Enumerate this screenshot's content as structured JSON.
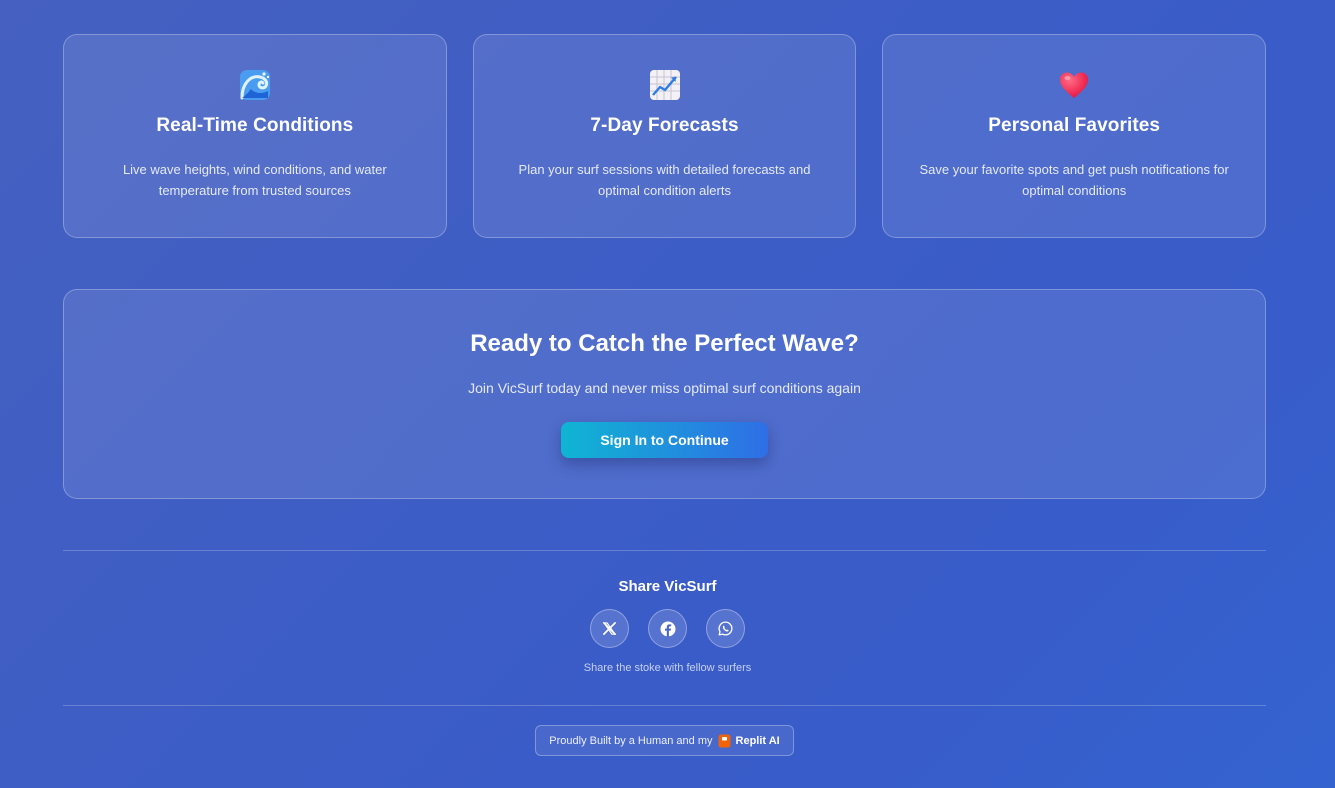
{
  "features": [
    {
      "icon": "wave-icon",
      "title": "Real-Time Conditions",
      "description": "Live wave heights, wind conditions, and water temperature from trusted sources"
    },
    {
      "icon": "chart-increasing-icon",
      "title": "7-Day Forecasts",
      "description": "Plan your surf sessions with detailed forecasts and optimal condition alerts"
    },
    {
      "icon": "heart-icon",
      "title": "Personal Favorites",
      "description": "Save your favorite spots and get push notifications for optimal conditions"
    }
  ],
  "cta": {
    "title": "Ready to Catch the Perfect Wave?",
    "subtitle": "Join VicSurf today and never miss optimal surf conditions again",
    "button_label": "Sign In to Continue"
  },
  "share": {
    "title": "Share VicSurf",
    "buttons": [
      "x-icon",
      "facebook-icon",
      "whatsapp-icon"
    ],
    "caption": "Share the stoke with fellow surfers"
  },
  "footer": {
    "built_prefix": "Proudly Built by a Human and my",
    "built_brand": "Replit AI"
  },
  "colors": {
    "background": "#3d5dc6",
    "button_gradient_start": "#0fb5d3",
    "button_gradient_end": "#2f6ee6",
    "replit_orange": "#f26207"
  }
}
